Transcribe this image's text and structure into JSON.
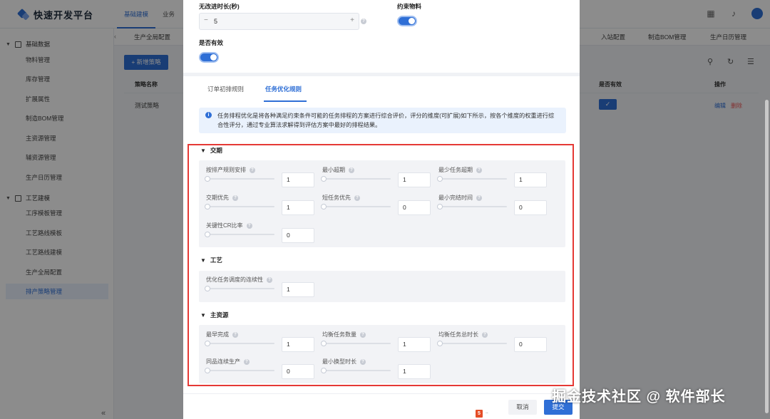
{
  "app": {
    "title": "快速开发平台"
  },
  "top_nav": [
    "基础建模",
    "业务"
  ],
  "sidebar": {
    "groups": [
      {
        "label": "基础数据",
        "items": [
          "物料管理",
          "库存管理",
          "扩展属性",
          "制造BOM管理",
          "主资源管理",
          "辅资源管理",
          "生产日历管理"
        ]
      },
      {
        "label": "工艺建模",
        "items": [
          "工序模板管理",
          "工艺路线模板",
          "工艺路线建模",
          "生产全局配置",
          "排产策略管理"
        ]
      }
    ],
    "active_item": "排产策略管理",
    "collapse_glyph": "«"
  },
  "bg_tabs": [
    "生产全局配置",
    "入站配置",
    "制造BOM管理",
    "生产日历管理"
  ],
  "bg_page": {
    "new_button": "+ 新增策略",
    "headers": {
      "name": "策略名称",
      "valid": "是否有效",
      "ops": "操作"
    },
    "row": {
      "name": "测试策略",
      "edit": "编辑",
      "delete": "删除"
    }
  },
  "modal": {
    "no_improve": {
      "label": "无改进时长(秒)",
      "value": "5",
      "minus": "−",
      "plus": "+"
    },
    "constraint_material": {
      "label": "约束物料",
      "on": true
    },
    "is_valid": {
      "label": "是否有效",
      "on": true
    },
    "tabs": [
      "订单初排规则",
      "任务优化规则"
    ],
    "active_tab": "任务优化规则",
    "info": "任务排程优化是将各种满足约束条件可能的任务排程的方案进行综合评价，评分的维度(可扩展)如下所示，按各个维度的权重进行综合性评分，通过专业算法求解得到评估方案中最好的排程结果。",
    "sections": [
      {
        "title": "交期",
        "params": [
          {
            "label": "按排产规则安排",
            "value": "1"
          },
          {
            "label": "最小超期",
            "value": "1"
          },
          {
            "label": "最少任务超期",
            "value": "1"
          },
          {
            "label": "交期优先",
            "value": "1"
          },
          {
            "label": "短任务优先",
            "value": "0"
          },
          {
            "label": "最小完结时间",
            "value": "0"
          },
          {
            "label": "关键性CR比率",
            "value": "0"
          }
        ]
      },
      {
        "title": "工艺",
        "params": [
          {
            "label": "优化任务调度的连续性",
            "value": "1"
          }
        ]
      },
      {
        "title": "主资源",
        "params": [
          {
            "label": "最早完成",
            "value": "1"
          },
          {
            "label": "均衡任务数量",
            "value": "1"
          },
          {
            "label": "均衡任务总时长",
            "value": "0"
          },
          {
            "label": "同品连续生产",
            "value": "0"
          },
          {
            "label": "最小换型时长",
            "value": "1"
          }
        ]
      }
    ],
    "footer": {
      "cancel": "取消",
      "submit": "提交"
    }
  },
  "watermark": "掘金技术社区 @ 软件部长",
  "colors": {
    "accent": "#2f6fd6",
    "highlight_border": "#e53935"
  }
}
